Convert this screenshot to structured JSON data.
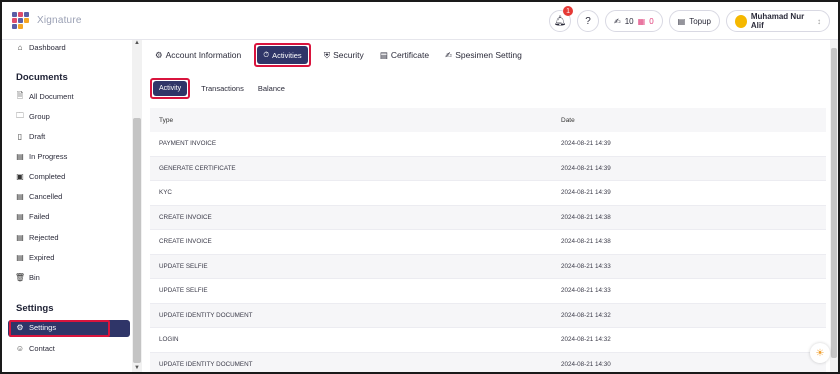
{
  "logo": {
    "text": "Xignature"
  },
  "topbar": {
    "notification_count": "1",
    "quota_sign": "10",
    "quota_stamp": "0",
    "topup_label": "Topup",
    "user_name": "Muhamad Nur Alif"
  },
  "sidebar": {
    "dashboard": "Dashboard",
    "documents_title": "Documents",
    "documents": [
      {
        "label": "All Document",
        "icon": "document-icon"
      },
      {
        "label": "Group",
        "icon": "folder-icon"
      },
      {
        "label": "Draft",
        "icon": "draft-icon"
      },
      {
        "label": "In Progress",
        "icon": "progress-icon"
      },
      {
        "label": "Completed",
        "icon": "completed-icon"
      },
      {
        "label": "Cancelled",
        "icon": "cancelled-icon"
      },
      {
        "label": "Failed",
        "icon": "failed-icon"
      },
      {
        "label": "Rejected",
        "icon": "rejected-icon"
      },
      {
        "label": "Expired",
        "icon": "expired-icon"
      },
      {
        "label": "Bin",
        "icon": "trash-icon"
      }
    ],
    "settings_title": "Settings",
    "settings": "Settings",
    "contact": "Contact"
  },
  "tabs": {
    "account": "Account Information",
    "activities": "Activities",
    "security": "Security",
    "certificate": "Certificate",
    "specimen": "Spesimen Setting"
  },
  "subtabs": {
    "activity": "Activity",
    "transactions": "Transactions",
    "balance": "Balance"
  },
  "table": {
    "headers": {
      "type": "Type",
      "date": "Date"
    },
    "rows": [
      {
        "type": "PAYMENT INVOICE",
        "date": "2024-08-21 14:39"
      },
      {
        "type": "GENERATE CERTIFICATE",
        "date": "2024-08-21 14:39"
      },
      {
        "type": "KYC",
        "date": "2024-08-21 14:39"
      },
      {
        "type": "CREATE INVOICE",
        "date": "2024-08-21 14:38"
      },
      {
        "type": "CREATE INVOICE",
        "date": "2024-08-21 14:38"
      },
      {
        "type": "UPDATE SELFIE",
        "date": "2024-08-21 14:33"
      },
      {
        "type": "UPDATE SELFIE",
        "date": "2024-08-21 14:33"
      },
      {
        "type": "UPDATE IDENTITY DOCUMENT",
        "date": "2024-08-21 14:32"
      },
      {
        "type": "LOGIN",
        "date": "2024-08-21 14:32"
      },
      {
        "type": "UPDATE IDENTITY DOCUMENT",
        "date": "2024-08-21 14:30"
      }
    ]
  },
  "colors": {
    "primary": "#2f3568",
    "highlight": "#d9143d",
    "accent_pink": "#e0407b",
    "avatar": "#f5b800"
  }
}
